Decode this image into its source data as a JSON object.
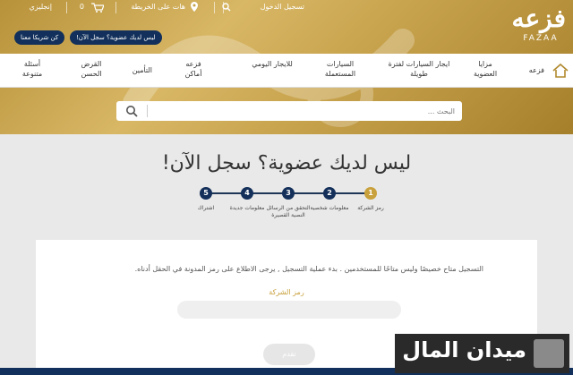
{
  "brand": {
    "logo_mark": "فزعه",
    "logo_word": "FAZAA"
  },
  "topbar": {
    "login": "تسجيل الدخول",
    "map": "هات على الخريطة",
    "cart_count": "0",
    "language": "إنجليزي"
  },
  "pills": {
    "register": "ليس لديك عضوية؟ سجل الآن!",
    "partner": "كن شريكا معنا"
  },
  "nav": {
    "items": [
      "فزعه",
      "مزايا العضوية",
      "ايجار السيارات لفترة طويلة",
      "السيارات المستعملة",
      "للايجار اليومي",
      "فزعه أماكن",
      "التأمين",
      "القرض الحسن",
      "أسئلة متنوعة"
    ]
  },
  "search": {
    "placeholder": "البحث ..."
  },
  "page": {
    "title": "ليس لديك عضوية؟ سجل الآن!"
  },
  "steps": [
    {
      "num": "1",
      "label": "رمز الشركة",
      "active": true
    },
    {
      "num": "2",
      "label": "معلومات شخصية",
      "active": false
    },
    {
      "num": "3",
      "label": "التحقق من الرسائل النصية القصيرة",
      "active": false
    },
    {
      "num": "4",
      "label": "معلومات جديدة",
      "active": false
    },
    {
      "num": "5",
      "label": "اشتراك",
      "active": false
    }
  ],
  "form": {
    "info_text": "التسجيل متاح خصيصًا وليس متاحًا للمستخدمين . بدء عملية التسجيل , يرجى الاطلاع على رمز المدونة في الحقل أدناه.",
    "field_label": "رمز الشركة",
    "submit": "تقدم"
  },
  "watermark": {
    "text": "ميدان المال"
  },
  "colors": {
    "gold": "#c9a13c",
    "navy": "#12305b"
  }
}
